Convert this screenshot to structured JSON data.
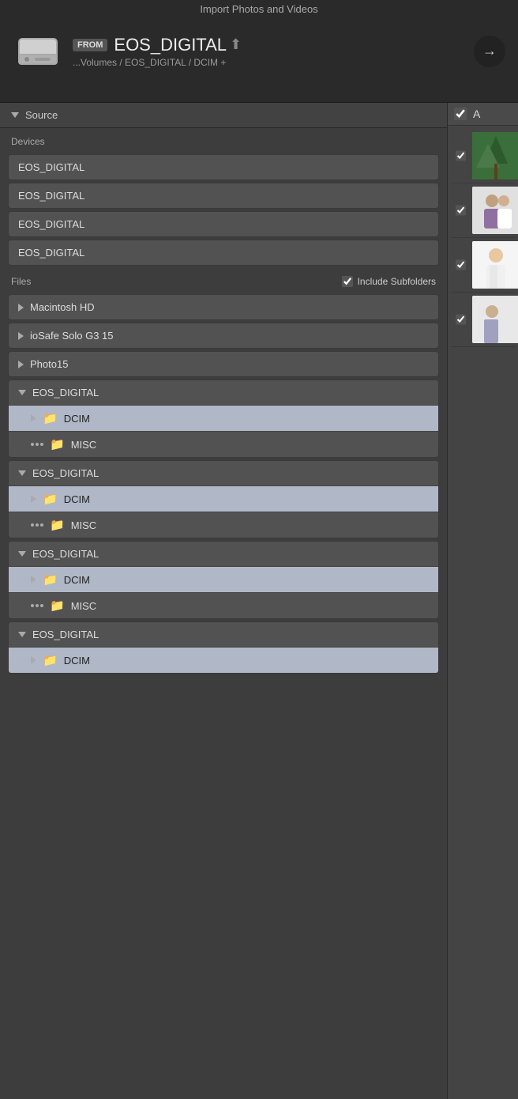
{
  "app": {
    "title": "Import Photos and Videos"
  },
  "header": {
    "from_label": "FROM",
    "device_name": "EOS_DIGITAL",
    "path": "...Volumes / EOS_DIGITAL / DCIM +",
    "arrow_label": "→"
  },
  "source_section": {
    "label": "Source"
  },
  "devices": {
    "label": "Devices",
    "items": [
      {
        "name": "EOS_DIGITAL"
      },
      {
        "name": "EOS_DIGITAL"
      },
      {
        "name": "EOS_DIGITAL"
      },
      {
        "name": "EOS_DIGITAL"
      }
    ]
  },
  "files": {
    "label": "Files",
    "include_subfolders_label": "Include Subfolders",
    "include_subfolders_checked": true,
    "tree_items": [
      {
        "id": "macintosh",
        "label": "Macintosh HD",
        "expanded": false
      },
      {
        "id": "iosafe",
        "label": "ioSafe Solo G3 15",
        "expanded": false
      },
      {
        "id": "photo15",
        "label": "Photo15",
        "expanded": false
      }
    ],
    "expanded_devices": [
      {
        "id": "eos1",
        "label": "EOS_DIGITAL",
        "children": [
          {
            "id": "dcim1",
            "label": "DCIM",
            "highlighted": true
          },
          {
            "id": "misc1",
            "label": "MISC",
            "highlighted": false
          }
        ]
      },
      {
        "id": "eos2",
        "label": "EOS_DIGITAL",
        "children": [
          {
            "id": "dcim2",
            "label": "DCIM",
            "highlighted": true
          },
          {
            "id": "misc2",
            "label": "MISC",
            "highlighted": false
          }
        ]
      },
      {
        "id": "eos3",
        "label": "EOS_DIGITAL",
        "children": [
          {
            "id": "dcim3",
            "label": "DCIM",
            "highlighted": true
          },
          {
            "id": "misc3",
            "label": "MISC",
            "highlighted": false
          }
        ]
      },
      {
        "id": "eos4",
        "label": "EOS_DIGITAL",
        "children": [
          {
            "id": "dcim4",
            "label": "DCIM",
            "highlighted": true
          }
        ]
      }
    ]
  },
  "right_panel": {
    "check_all_label": "A",
    "photos": [
      {
        "id": 1,
        "checked": true,
        "thumb_class": "photo-thumb-trees"
      },
      {
        "id": 2,
        "checked": true,
        "thumb_class": "photo-thumb-couple"
      },
      {
        "id": 3,
        "checked": true,
        "thumb_class": "photo-thumb-wedding"
      },
      {
        "id": 4,
        "checked": true,
        "thumb_class": "photo-thumb-4"
      }
    ]
  }
}
